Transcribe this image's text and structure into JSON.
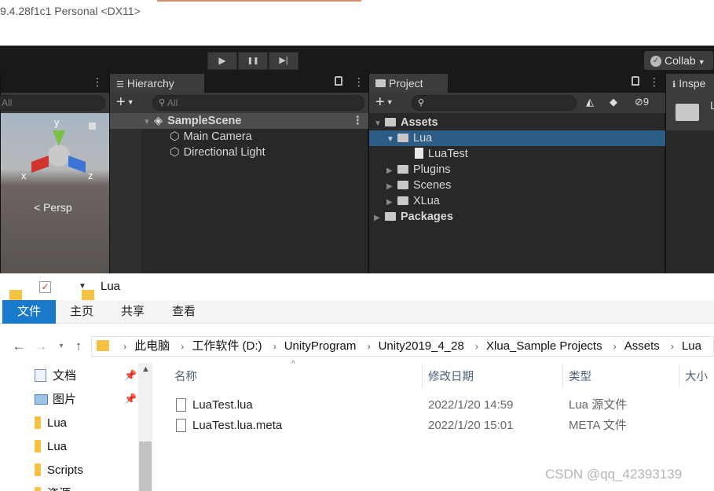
{
  "window": {
    "title": "9.4.28f1c1 Personal <DX11>"
  },
  "toolbar": {
    "play": "▶",
    "pause": "❚❚",
    "step": "▶|",
    "collab": "Collab"
  },
  "scene": {
    "search_placeholder": "All",
    "persp": "Persp",
    "axis_y": "y",
    "axis_x": "x",
    "axis_z": "z"
  },
  "hierarchy": {
    "tab": "Hierarchy",
    "search_placeholder": "All",
    "add": "+",
    "scene": "SampleScene",
    "items": [
      "Main Camera",
      "Directional Light"
    ]
  },
  "project": {
    "tab": "Project",
    "add": "+",
    "hidden_count": "9",
    "assets": "Assets",
    "lua": "Lua",
    "luatest": "LuaTest",
    "folders": [
      "Plugins",
      "Scenes",
      "XLua"
    ],
    "packages": "Packages"
  },
  "inspector": {
    "tab": "Inspe",
    "lock": "L"
  },
  "explorer": {
    "qa_title": "Lua",
    "ribbon": [
      "文件",
      "主页",
      "共享",
      "查看"
    ],
    "breadcrumb": [
      "此电脑",
      "工作软件 (D:)",
      "UnityProgram",
      "Unity2019_4_28",
      "Xlua_Sample Projects",
      "Assets",
      "Lua"
    ],
    "sidebar": [
      "文档",
      "图片",
      "Lua",
      "Lua",
      "Scripts",
      "资源"
    ],
    "columns": [
      "名称",
      "修改日期",
      "类型",
      "大小"
    ],
    "files": [
      {
        "name": "LuaTest.lua",
        "date": "2022/1/20 14:59",
        "type": "Lua 源文件"
      },
      {
        "name": "LuaTest.lua.meta",
        "date": "2022/1/20 15:01",
        "type": "META 文件"
      }
    ]
  },
  "watermark": "CSDN @qq_42393139",
  "colors": {
    "selection": "#2c5d87",
    "unity_bg": "#282828",
    "ribbon_active": "#1979ca"
  }
}
